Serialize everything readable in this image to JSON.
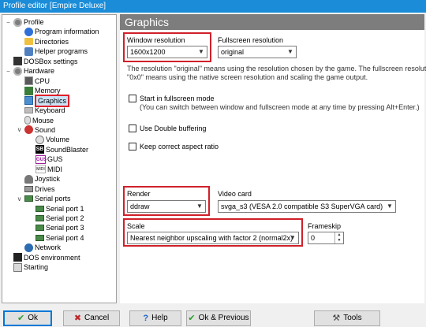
{
  "window": {
    "title": "Profile editor [Empire Deluxe]"
  },
  "tree": [
    {
      "label": "Profile",
      "icon": "gear-icon",
      "level": 0,
      "expander": "−"
    },
    {
      "label": "Program information",
      "icon": "info-icon",
      "level": 1
    },
    {
      "label": "Directories",
      "icon": "folder-icon",
      "level": 1
    },
    {
      "label": "Helper programs",
      "icon": "helper-icon",
      "level": 1
    },
    {
      "label": "DOSBox settings",
      "icon": "dosbox-icon",
      "level": 0
    },
    {
      "label": "Hardware",
      "icon": "gear-icon",
      "level": 0,
      "expander": "−"
    },
    {
      "label": "CPU",
      "icon": "cpu-icon",
      "level": 1
    },
    {
      "label": "Memory",
      "icon": "memory-icon",
      "level": 1
    },
    {
      "label": "Graphics",
      "icon": "graphics-icon",
      "level": 1,
      "selected": true
    },
    {
      "label": "Keyboard",
      "icon": "keyboard-icon",
      "level": 1
    },
    {
      "label": "Mouse",
      "icon": "mouse-icon",
      "level": 1
    },
    {
      "label": "Sound",
      "icon": "sound-icon",
      "level": 1,
      "expander": "∨"
    },
    {
      "label": "Volume",
      "icon": "volume-icon",
      "level": 2
    },
    {
      "label": "SoundBlaster",
      "icon": "soundblaster-icon",
      "level": 2
    },
    {
      "label": "GUS",
      "icon": "gus-icon",
      "level": 2
    },
    {
      "label": "MIDI",
      "icon": "midi-icon",
      "level": 2
    },
    {
      "label": "Joystick",
      "icon": "joystick-icon",
      "level": 1
    },
    {
      "label": "Drives",
      "icon": "drive-icon",
      "level": 1
    },
    {
      "label": "Serial ports",
      "icon": "serial-icon",
      "level": 1,
      "expander": "∨"
    },
    {
      "label": "Serial port 1",
      "icon": "serial-icon",
      "level": 2
    },
    {
      "label": "Serial port 2",
      "icon": "serial-icon",
      "level": 2
    },
    {
      "label": "Serial port 3",
      "icon": "serial-icon",
      "level": 2
    },
    {
      "label": "Serial port 4",
      "icon": "serial-icon",
      "level": 2
    },
    {
      "label": "Network",
      "icon": "network-icon",
      "level": 1
    },
    {
      "label": "DOS environment",
      "icon": "dos-environment-icon",
      "level": 0
    },
    {
      "label": "Starting",
      "icon": "starting-icon",
      "level": 0
    }
  ],
  "panel": {
    "title": "Graphics",
    "window_resolution": {
      "label": "Window resolution",
      "value": "1600x1200"
    },
    "fullscreen_resolution": {
      "label": "Fullscreen resolution",
      "value": "original"
    },
    "resolution_note_1": "The resolution \"original\" means using the resolution chosen by the game. The fullscreen resolution",
    "resolution_note_2": "\"0x0\" means using the native screen resolution and scaling the game output.",
    "start_fullscreen": {
      "label": "Start in fullscreen mode",
      "checked": false
    },
    "fullscreen_note": "(You can switch between window and fullscreen mode at any time by pressing Alt+Enter.)",
    "double_buffering": {
      "label": "Use Double buffering",
      "checked": false
    },
    "aspect_ratio": {
      "label": "Keep correct aspect ratio",
      "checked": false
    },
    "render": {
      "label": "Render",
      "value": "ddraw"
    },
    "video_card": {
      "label": "Video card",
      "value": "svga_s3 (VESA 2.0 compatible S3 SuperVGA card)"
    },
    "scale": {
      "label": "Scale",
      "value": "Nearest neighbor upscaling with factor 2 (normal2x)"
    },
    "frameskip": {
      "label": "Frameskip",
      "value": "0"
    }
  },
  "buttons": {
    "ok": "Ok",
    "cancel": "Cancel",
    "help": "Help",
    "ok_previous": "Ok & Previous",
    "tools": "Tools"
  },
  "colors": {
    "accent": "#0078d7",
    "highlight": "#d0202a",
    "header": "#7d7d7d"
  }
}
